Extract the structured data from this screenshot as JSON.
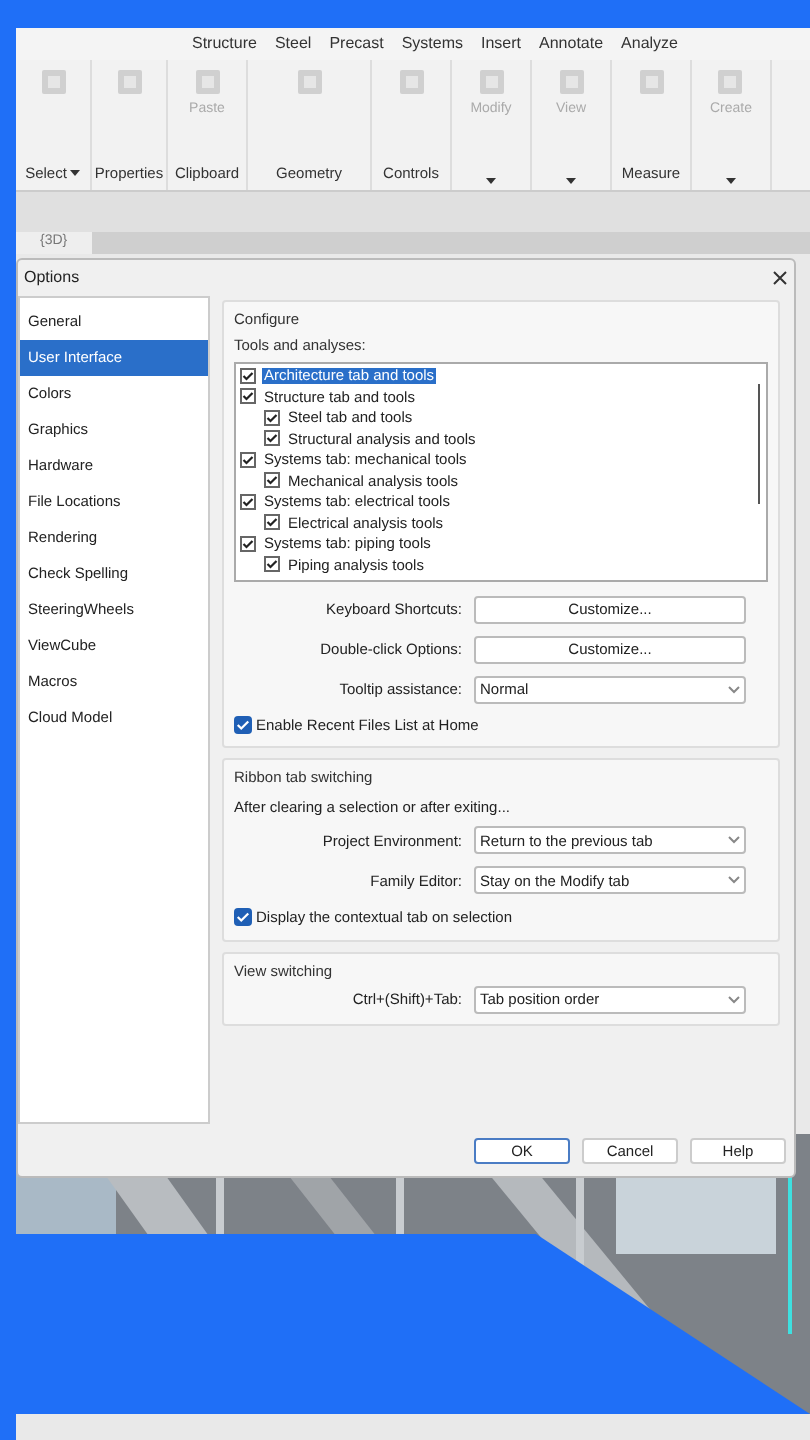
{
  "ribbon": {
    "tabs": [
      "Structure",
      "Steel",
      "Precast",
      "Systems",
      "Insert",
      "Annotate",
      "Analyze"
    ],
    "panels": [
      {
        "label": "Select",
        "dropdown": true
      },
      {
        "label": "Properties"
      },
      {
        "label": "Clipboard",
        "tools": [
          "Paste"
        ]
      },
      {
        "label": "Geometry"
      },
      {
        "label": "Controls"
      },
      {
        "dropdown": true,
        "tools": [
          "Modify"
        ]
      },
      {
        "dropdown": true,
        "tools": [
          "View"
        ]
      },
      {
        "label": "Measure"
      },
      {
        "dropdown": true,
        "tools": [
          "Create"
        ]
      }
    ]
  },
  "view_tab": {
    "label": "{3D}"
  },
  "dialog": {
    "title": "Options",
    "nav": [
      {
        "label": "General",
        "selected": false
      },
      {
        "label": "User Interface",
        "selected": true
      },
      {
        "label": "Colors",
        "selected": false
      },
      {
        "label": "Graphics",
        "selected": false
      },
      {
        "label": "Hardware",
        "selected": false
      },
      {
        "label": "File Locations",
        "selected": false
      },
      {
        "label": "Rendering",
        "selected": false
      },
      {
        "label": "Check Spelling",
        "selected": false
      },
      {
        "label": "SteeringWheels",
        "selected": false
      },
      {
        "label": "ViewCube",
        "selected": false
      },
      {
        "label": "Macros",
        "selected": false
      },
      {
        "label": "Cloud Model",
        "selected": false
      }
    ],
    "configure": {
      "title": "Configure",
      "list_label": "Tools and analyses:",
      "tools": [
        {
          "label": "Architecture tab and tools",
          "checked": true,
          "selected": true
        },
        {
          "label": "Structure tab and tools",
          "checked": true,
          "selected": false,
          "children": [
            {
              "label": "Steel tab and tools",
              "checked": true,
              "selected": false
            },
            {
              "label": "Structural analysis and tools",
              "checked": true,
              "selected": false
            }
          ]
        },
        {
          "label": "Systems tab: mechanical tools",
          "checked": true,
          "selected": false,
          "children": [
            {
              "label": "Mechanical analysis tools",
              "checked": true,
              "selected": false
            }
          ]
        },
        {
          "label": "Systems tab: electrical tools",
          "checked": true,
          "selected": false,
          "children": [
            {
              "label": "Electrical analysis tools",
              "checked": true,
              "selected": false
            }
          ]
        },
        {
          "label": "Systems tab: piping tools",
          "checked": true,
          "selected": false,
          "children": [
            {
              "label": "Piping analysis tools",
              "checked": true,
              "selected": false
            }
          ]
        }
      ],
      "rows": [
        {
          "label": "Keyboard Shortcuts:",
          "kind": "button",
          "value": "Customize..."
        },
        {
          "label": "Double-click Options:",
          "kind": "button",
          "value": "Customize..."
        },
        {
          "label": "Tooltip assistance:",
          "kind": "select",
          "value": "Normal"
        }
      ],
      "checkbox": {
        "label": "Enable Recent Files List at Home",
        "checked": true
      }
    },
    "ribbon_switching": {
      "title": "Ribbon tab switching",
      "intro": "After clearing a selection or after exiting...",
      "rows": [
        {
          "label": "Project Environment:",
          "kind": "select",
          "value": "Return to the previous tab"
        },
        {
          "label": "Family Editor:",
          "kind": "select",
          "value": "Stay on the Modify tab"
        }
      ],
      "checkbox": {
        "label": "Display the contextual tab on selection",
        "checked": true
      }
    },
    "view_switching": {
      "title": "View switching",
      "rows": [
        {
          "label": "Ctrl+(Shift)+Tab:",
          "kind": "select",
          "value": "Tab position order"
        }
      ]
    },
    "buttons": [
      {
        "label": "OK",
        "default": true
      },
      {
        "label": "Cancel",
        "default": false
      },
      {
        "label": "Help",
        "default": false
      }
    ]
  }
}
